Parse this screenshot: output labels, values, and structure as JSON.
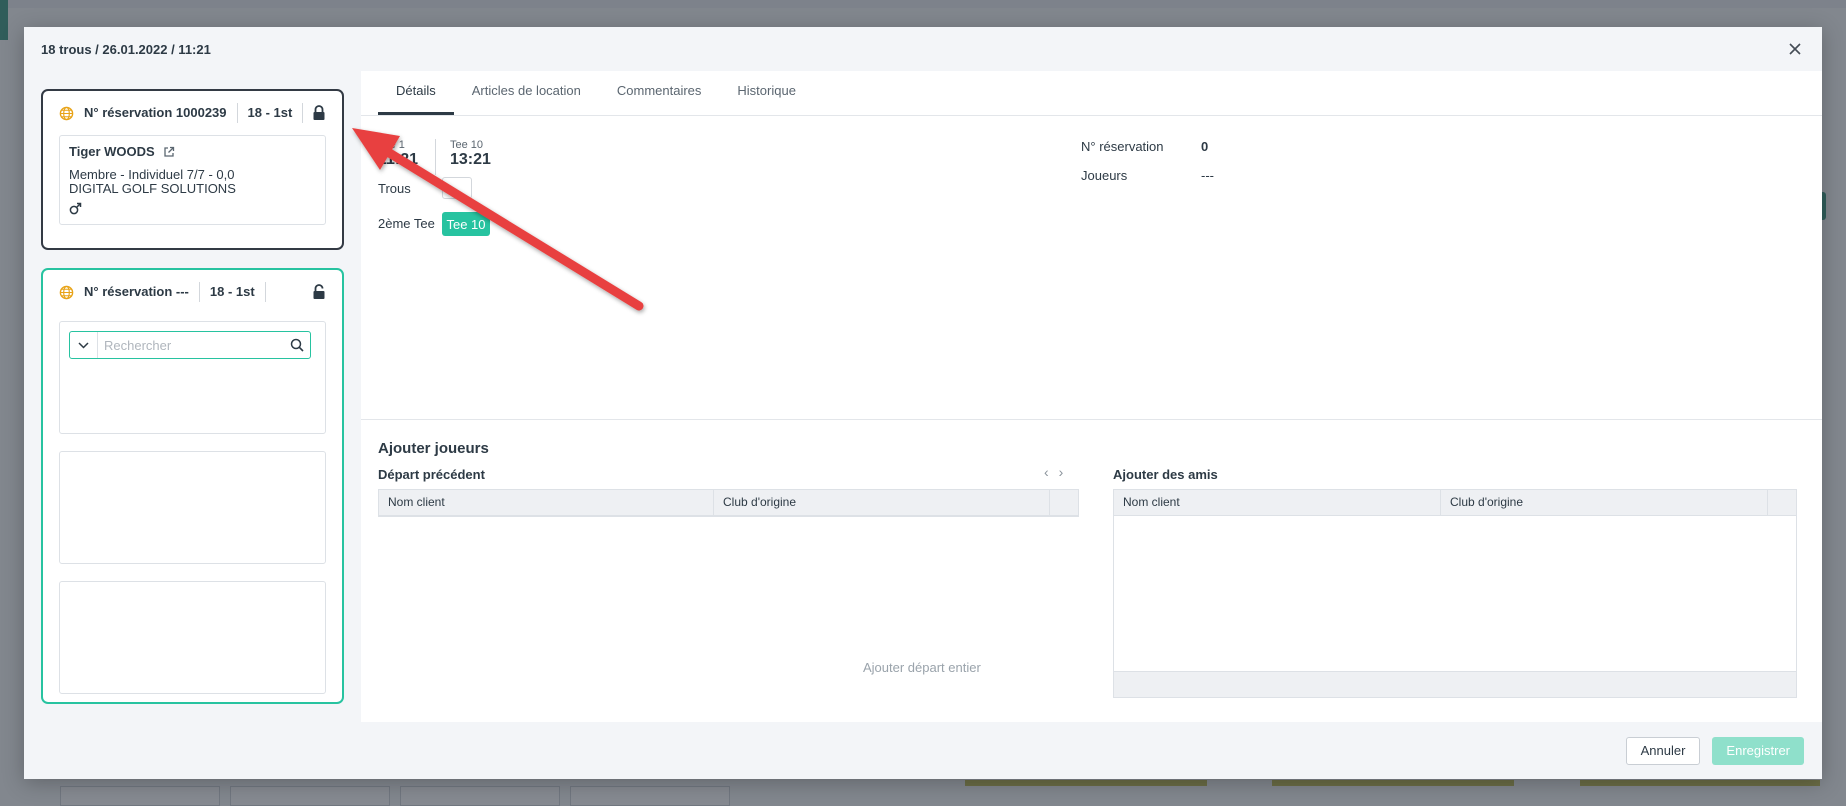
{
  "modal": {
    "title": "18 trous / 26.01.2022 / 11:21"
  },
  "reservations": [
    {
      "number_label": "N° réservation 1000239",
      "holes_label": "18 - 1st",
      "locked": true,
      "player": {
        "name": "Tiger WOODS",
        "membership": "Membre - Individuel 7/7 - 0,0",
        "club": "DIGITAL GOLF SOLUTIONS",
        "gender_icon": "male-icon"
      }
    },
    {
      "number_label": "N° réservation ---",
      "holes_label": "18 - 1st",
      "locked": false,
      "search_placeholder": "Rechercher"
    }
  ],
  "tabs": [
    {
      "label": "Détails",
      "active": true
    },
    {
      "label": "Articles de location",
      "active": false
    },
    {
      "label": "Commentaires",
      "active": false
    },
    {
      "label": "Historique",
      "active": false
    }
  ],
  "details": {
    "tee1_label": "Tee 1",
    "tee1_time": "11:21",
    "tee10_label": "Tee 10",
    "tee10_time": "13:21",
    "holes_label": "Trous",
    "second_tee_label": "2ème Tee",
    "second_tee_value": "Tee 10",
    "reservation_label": "N° réservation",
    "reservation_value": "0",
    "players_label": "Joueurs",
    "players_value": "---"
  },
  "add_players": {
    "title": "Ajouter joueurs",
    "previous_departure": {
      "title": "Départ précédent",
      "columns": [
        "Nom client",
        "Club d'origine"
      ],
      "add_all_label": "Ajouter départ entier"
    },
    "friends": {
      "title": "Ajouter des amis",
      "columns": [
        "Nom client",
        "Club d'origine"
      ]
    }
  },
  "footer": {
    "cancel_label": "Annuler",
    "save_label": "Enregistrer"
  },
  "colors": {
    "accent": "#27c3a0",
    "annotation_arrow": "#e8413f",
    "globe": "#e8a317"
  }
}
